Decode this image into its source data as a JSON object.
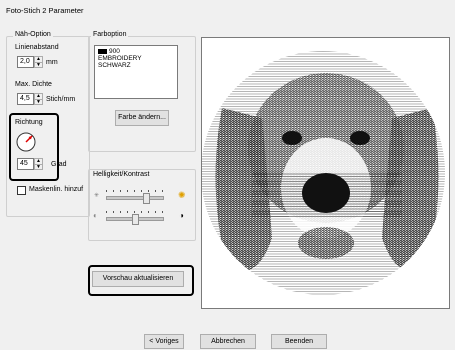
{
  "window": {
    "title": "Foto-Stich 2 Parameter"
  },
  "naeh_option": {
    "group_title": "Näh-Option",
    "linienabstand_label": "Linienabstand",
    "linienabstand_value": "2,0",
    "linienabstand_unit": "mm",
    "max_dichte_label": "Max. Dichte",
    "max_dichte_value": "4,5",
    "max_dichte_unit": "Stich/mm",
    "richtung_label": "Richtung",
    "richtung_value": "45",
    "richtung_unit": "Grad",
    "maskenlinie_label": "Maskenlin. hinzuf"
  },
  "farboption": {
    "group_title": "Farboption",
    "color_swatch": "#000000",
    "color_number": "900",
    "color_brand": "EMBROIDERY",
    "color_name": "SCHWARZ",
    "farbe_aendern_label": "Farbe ändern..."
  },
  "helligkeit": {
    "group_title": "Helligkeit/Kontrast",
    "brightness_level": 0.72,
    "contrast_level": 0.52
  },
  "buttons": {
    "vorschau_label": "Vorschau aktualisieren",
    "voriges_label": "< Voriges",
    "abbrechen_label": "Abbrechen",
    "beenden_label": "Beenden"
  }
}
